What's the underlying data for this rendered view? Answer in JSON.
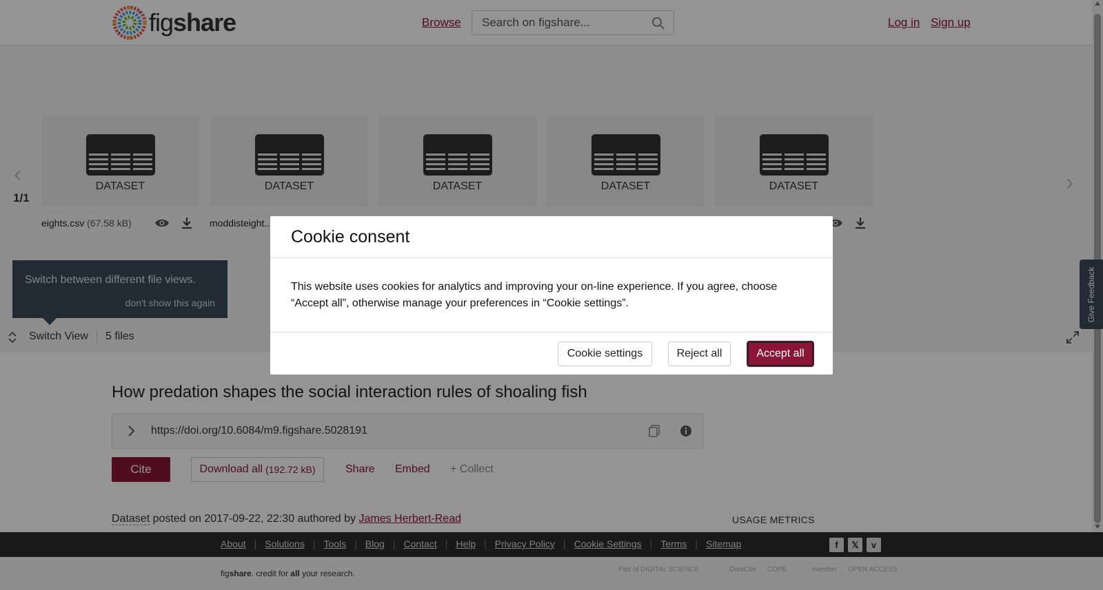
{
  "header": {
    "logo_fig": "fig",
    "logo_share": "share",
    "browse": "Browse",
    "search_placeholder": "Search on figshare...",
    "login": "Log in",
    "signup": "Sign up"
  },
  "viewer": {
    "pager": "1/1",
    "cards": [
      {
        "label": "DATASET"
      },
      {
        "label": "DATASET"
      },
      {
        "label": "DATASET"
      },
      {
        "label": "DATASET"
      },
      {
        "label": "DATASET"
      }
    ],
    "files": [
      {
        "name": "eights.csv",
        "size": "(67.58 kB)"
      },
      {
        "name": "moddisteight..."
      }
    ],
    "tooltip": {
      "text": "Switch between different file views.",
      "dismiss": "don't show this again"
    },
    "switch_view": "Switch View",
    "file_count": "5 files"
  },
  "article": {
    "title": "How predation shapes the social interaction rules of shoaling fish",
    "doi": "https://doi.org/10.6084/m9.figshare.5028191",
    "cite": "Cite",
    "download_all": "Download all",
    "download_size": "(192.72 kB)",
    "share": "Share",
    "embed": "Embed",
    "collect": "+ Collect",
    "posted": {
      "type": "Dataset",
      "text": " posted on 2017-09-22, 22:30 authored by ",
      "author": "James Herbert-Read"
    },
    "usage_metrics": "USAGE METRICS"
  },
  "feedback": "Give Feedback",
  "footer": {
    "links": [
      "About",
      "Solutions",
      "Tools",
      "Blog",
      "Contact",
      "Help",
      "Privacy Policy",
      "Cookie Settings",
      "Terms",
      "Sitemap"
    ],
    "social": [
      "facebook-icon",
      "x-icon",
      "vimeo-icon"
    ],
    "credit_fig": "fig",
    "credit_share": "share",
    "credit_mid": ". credit for ",
    "credit_all": "all",
    "credit_end": " your research.",
    "partners": [
      "Part of DIGITAL SCIENCE",
      "DataCite",
      "COPE",
      "member",
      "OPEN ACCESS"
    ]
  },
  "cookie": {
    "title": "Cookie consent",
    "body": "This website uses cookies for analytics and improving your on-line experience. If you agree, choose “Accept all”, otherwise manage your preferences in “Cookie settings”.",
    "settings": "Cookie settings",
    "reject": "Reject all",
    "accept": "Accept all"
  },
  "colors": {
    "brand": "#8a1538",
    "tooltip_bg": "#3b4a5a",
    "footer_bg": "#2b2b2b"
  }
}
